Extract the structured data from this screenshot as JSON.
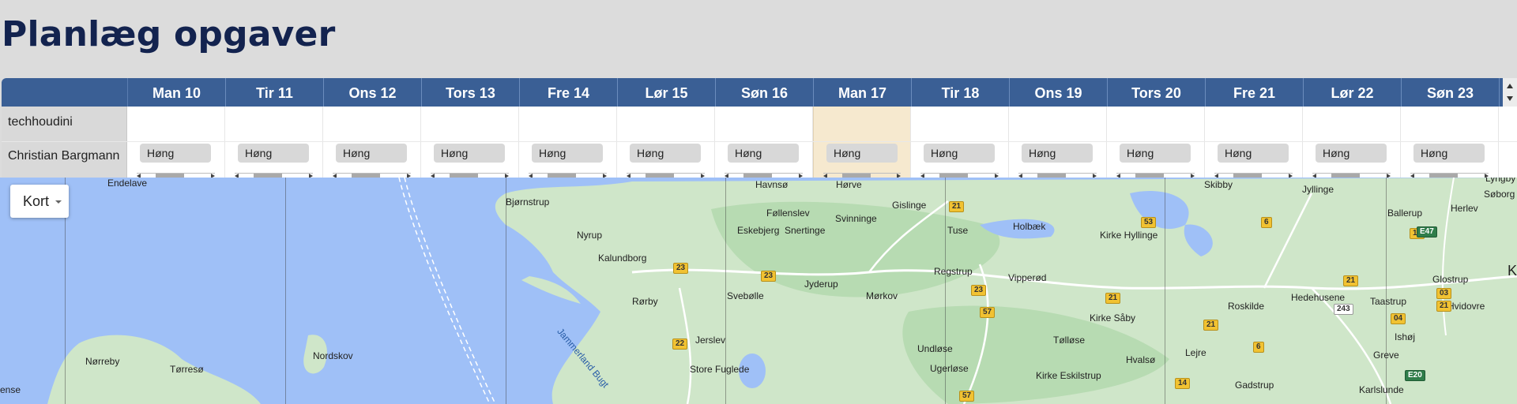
{
  "page": {
    "title": "Planlæg opgaver"
  },
  "calendar": {
    "days": [
      "Man 10",
      "Tir 11",
      "Ons 12",
      "Tors 13",
      "Fre 14",
      "Lør 15",
      "Søn 16",
      "Man 17",
      "Tir 18",
      "Ons 19",
      "Tors 20",
      "Fre 21",
      "Lør 22",
      "Søn 23"
    ],
    "today_index": 7,
    "rows": [
      {
        "label": "techhoudini",
        "tasks": []
      },
      {
        "label": "Christian Bargmann",
        "tasks": [
          "Høng",
          "Høng",
          "Høng",
          "Høng",
          "Høng",
          "Høng",
          "Høng",
          "Høng",
          "Høng",
          "Høng",
          "Høng",
          "Høng",
          "Høng",
          "Høng"
        ]
      }
    ]
  },
  "map": {
    "type_button": "Kort",
    "places": [
      "Endelave",
      "Bjørnstrup",
      "Havnsø",
      "Hørve",
      "Skibby",
      "Jyllinge",
      "Lyngby",
      "Søborg",
      "Herlev",
      "Ballerup",
      "Føllenslev",
      "Svinninge",
      "Gislinge",
      "Eskebjerg",
      "Snertinge",
      "Tuse",
      "Holbæk",
      "Kirke Hyllinge",
      "Nyrup",
      "Kalundborg",
      "Jyderup",
      "Regstrup",
      "Vipperød",
      "Glostrup",
      "Hedehusene",
      "Taastrup",
      "Roskilde",
      "Hvidovre",
      "Rørby",
      "Svebølle",
      "Mørkov",
      "Kirke Såby",
      "Ishøj",
      "Nordskov",
      "Nørreby",
      "Tørresø",
      "Jerslev",
      "Undløse",
      "Tølløse",
      "Hvalsø",
      "Lejre",
      "Greve",
      "Store Fuglede",
      "Ugerløse",
      "Kirke Eskilstrup",
      "Gadstrup",
      "Karlslunde",
      "ense",
      "K"
    ],
    "water_labels": [
      "Jammerland Bugt"
    ],
    "road_shields": [
      "23",
      "23",
      "23",
      "22",
      "21",
      "21",
      "21",
      "21",
      "53",
      "6",
      "6",
      "17",
      "21",
      "03",
      "04",
      "243",
      "57",
      "57",
      "14",
      "E47",
      "E20"
    ]
  }
}
